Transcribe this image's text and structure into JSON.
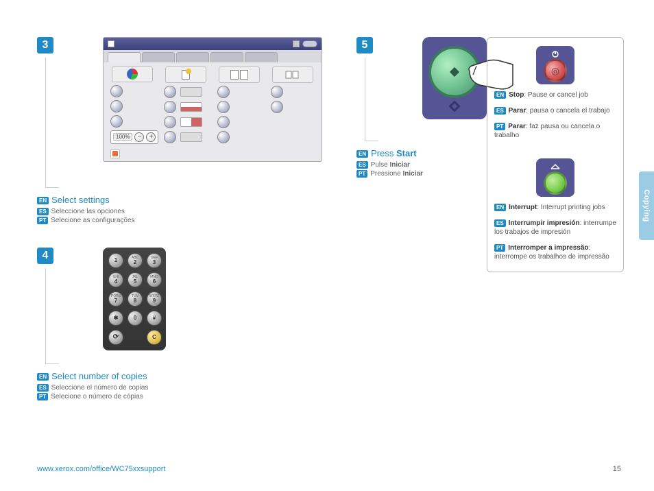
{
  "steps": {
    "s3": {
      "num": "3",
      "en_title": "Select settings",
      "es": "Seleccione las opciones",
      "pt": "Selecione as configurações",
      "zoom": "100%"
    },
    "s4": {
      "num": "4",
      "en_title": "Select number of copies",
      "es": "Seleccione el número de copias",
      "pt": "Selecione o número de cópias",
      "keys": {
        "k1": "1",
        "k2": "2",
        "k3": "3",
        "k4": "4",
        "k5": "5",
        "k6": "6",
        "k7": "7",
        "k8": "8",
        "k9": "9",
        "kstar": "✱",
        "k0": "0",
        "khash": "#",
        "kC": "C",
        "l2": "ABC",
        "l3": "DEF",
        "l4": "GHI",
        "l5": "JKL",
        "l6": "MNO",
        "l7": "PQRS",
        "l8": "TUV",
        "l9": "WXYZ"
      }
    },
    "s5": {
      "num": "5",
      "en_pre": "Press ",
      "en_bold": "Start",
      "es_pre": "Pulse ",
      "es_bold": "Iniciar",
      "pt_pre": "Pressione ",
      "pt_bold": "Iniciar"
    }
  },
  "info": {
    "stop": {
      "en_bold": "Stop",
      "en_rest": ": Pause or cancel job",
      "es_bold": "Parar",
      "es_rest": ": pausa o cancela el trabajo",
      "pt_bold": "Parar",
      "pt_rest": ": faz pausa ou cancela o trabalho"
    },
    "interrupt": {
      "en_bold": "Interrupt",
      "en_rest": ": Interrupt printing jobs",
      "es_bold": "Interrumpir impresión",
      "es_rest": ": interrumpe los trabajos de impresión",
      "pt_bold": "Interromper a impressão",
      "pt_rest": ": interrompe os trabalhos de impressão"
    }
  },
  "lang": {
    "en": "EN",
    "es": "ES",
    "pt": "PT"
  },
  "sidetab": "Copying",
  "footer": {
    "url": "www.xerox.com/office/WC75xxsupport",
    "page": "15"
  }
}
